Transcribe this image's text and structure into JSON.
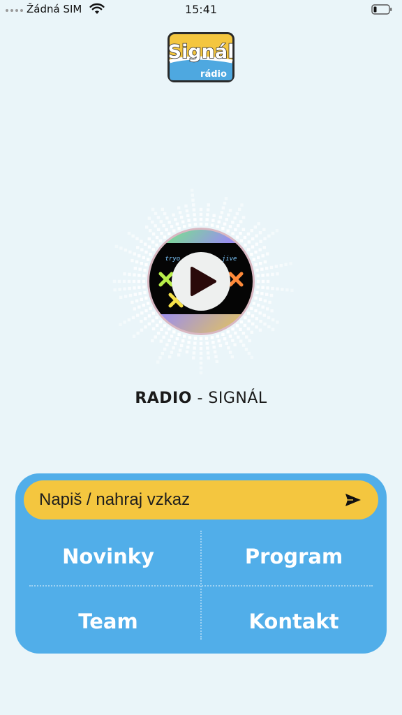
{
  "status_bar": {
    "carrier": "Žádná SIM",
    "time": "15:41"
  },
  "logo": {
    "text_main": "Signál",
    "text_sub": "rádio"
  },
  "player": {
    "cover_text": "tryo · badroom jive",
    "station_name_bold": "RADIO",
    "station_name_rest": " - SIGNÁL"
  },
  "panel": {
    "message_label": "Napiš / nahraj vzkaz",
    "menu": {
      "news": "Novinky",
      "program": "Program",
      "team": "Team",
      "contact": "Kontakt"
    }
  },
  "colors": {
    "background": "#eaf5f9",
    "panel_blue": "#51aee9",
    "message_yellow": "#f4c63f",
    "logo_yellow": "#f4c63f",
    "logo_blue": "#4ea8e0"
  },
  "icons": [
    "signal-dots-icon",
    "wifi-icon",
    "battery-icon",
    "play-icon",
    "send-icon"
  ]
}
